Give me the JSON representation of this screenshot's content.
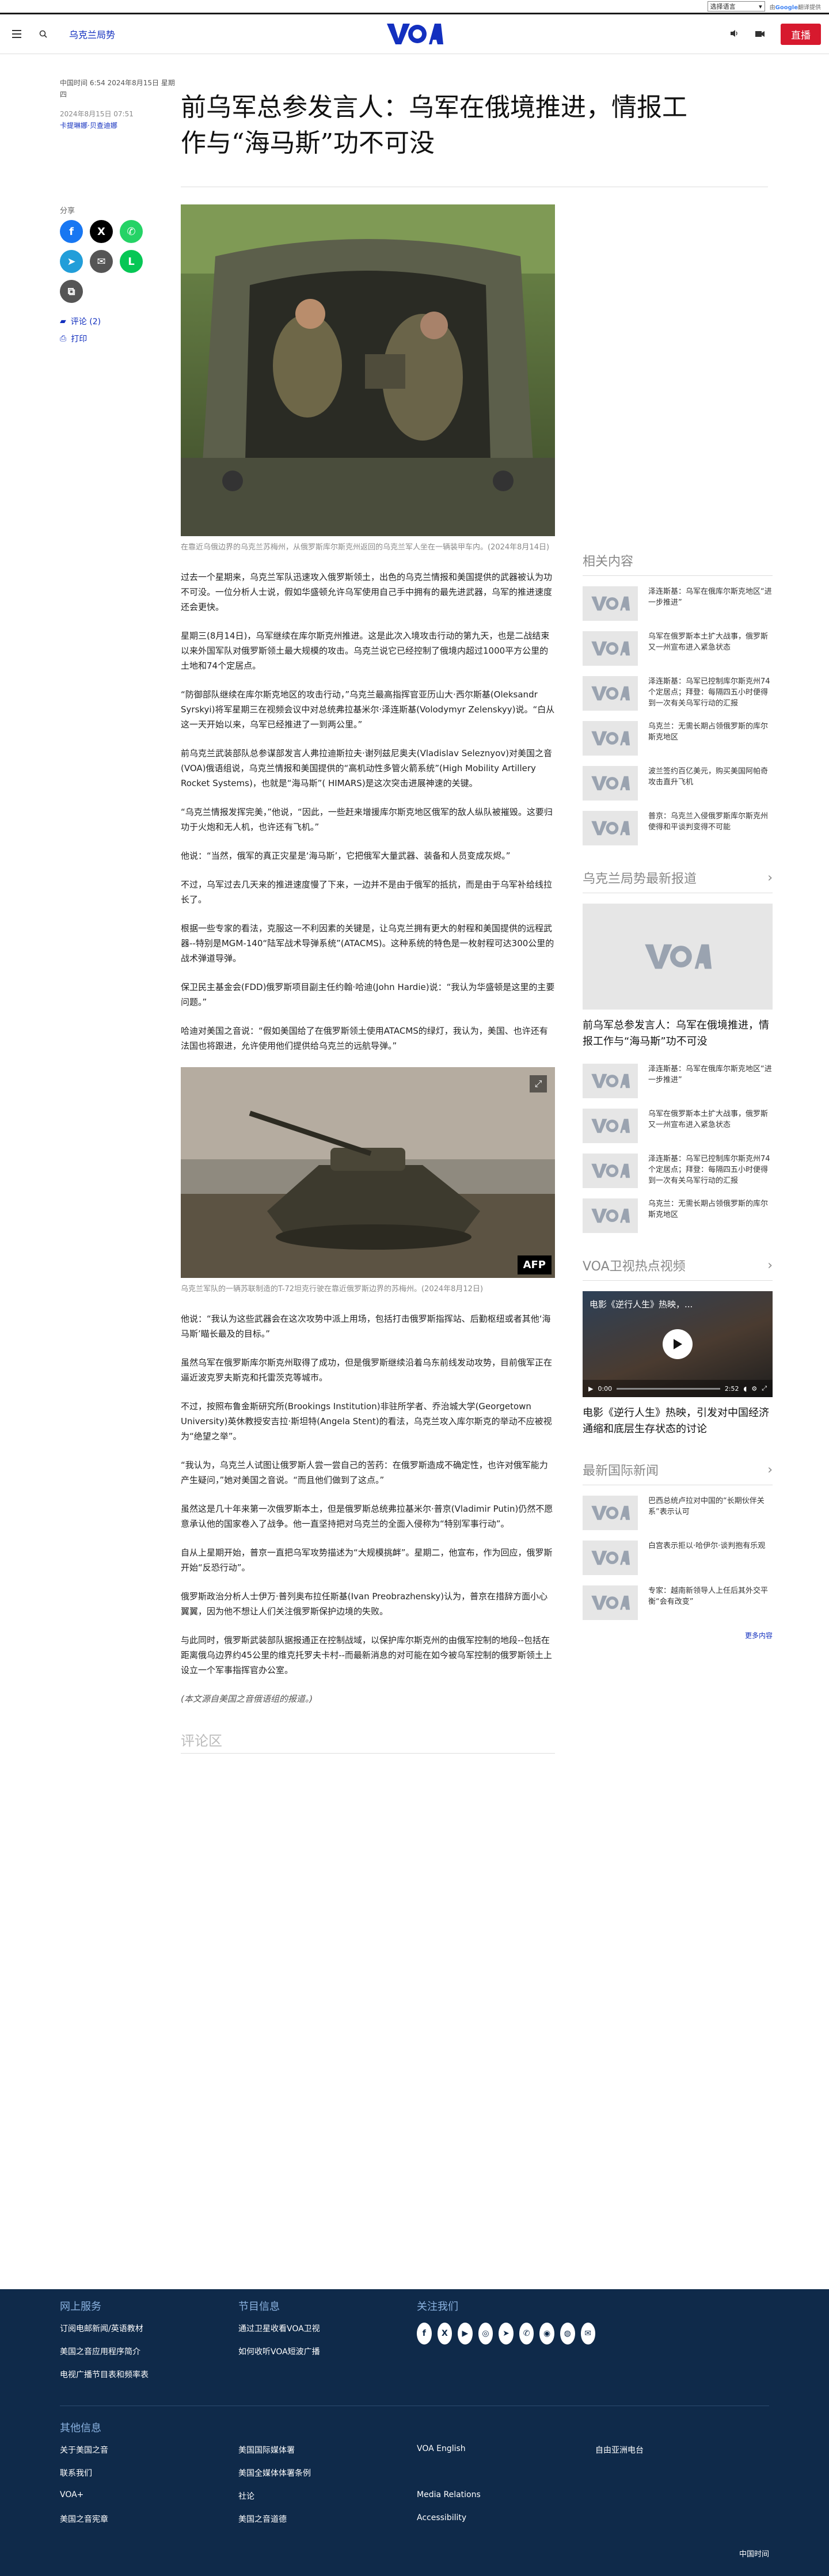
{
  "util": {
    "lang_select": "选择语言",
    "powered_prefix": "由",
    "powered_brand": "Google",
    "powered_suffix": "翻译提供"
  },
  "header": {
    "section_link": "乌克兰局势",
    "logo_text": "VOA",
    "live_label": "直播"
  },
  "article": {
    "dateline": "中国时间 6:54 2024年8月15日 星期四",
    "published": "2024年8月15日 07:51",
    "author": "卡提琳娜·贝查迪娜",
    "title": "前乌军总参发言人：乌军在俄境推进，情报工作与“海马斯”功不可没",
    "hero_caption": "在靠近乌俄边界的乌克兰苏梅州，从俄罗斯库尔斯克州返回的乌克兰军人坐在一辆装甲车内。(2024年8月14日)",
    "paragraphs_a": [
      "过去一个星期来，乌克兰军队迅速攻入俄罗斯领土，出色的乌克兰情报和美国提供的武器被认为功不可没。一位分析人士说，假如华盛顿允许乌军使用自己手中拥有的最先进武器，乌军的推进速度还会更快。",
      "星期三(8月14日)，乌军继续在库尔斯克州推进。这是此次入境攻击行动的第九天，也是二战结束以来外国军队对俄罗斯领土最大规模的攻击。乌克兰说它已经控制了俄境内超过1000平方公里的土地和74个定居点。",
      "“防御部队继续在库尔斯克地区的攻击行动，”乌克兰最高指挥官亚历山大·西尔斯基(Oleksandr Syrskyi)将军星期三在视频会议中对总统弗拉基米尔·泽连斯基(Volodymyr Zelenskyy)说。“白从这一天开始以来，乌军已经推进了一到两公里。”",
      "前乌克兰武装部队总参谋部发言人弗拉迪斯拉夫·谢列兹尼奥夫(Vladislav Seleznyov)对美国之音(VOA)俄语组说，乌克兰情报和美国提供的“高机动性多管火箭系统”(High Mobility Artillery Rocket Systems)，也就是“海马斯”( HIMARS)是这次突击进展神速的关键。",
      "“乌克兰情报发挥完美，”他说，“因此，一些赶来增援库尔斯克地区俄军的敌人纵队被摧毁。这要归功于火炮和无人机，也许还有飞机。”",
      "他说：“当然，俄军的真正灾星是‘海马斯’，它把俄军大量武器、装备和人员变成灰烬。”",
      "不过，乌军过去几天来的推进速度慢了下来，一边并不是由于俄军的抵抗，而是由于乌军补给线拉长了。",
      "根据一些专家的看法，克服这一不利因素的关键是，让乌克兰拥有更大的射程和美国提供的远程武器--特别是MGM-140“陆军战术导弹系统”(ATACMS)。这种系统的特色是一枚射程可达300公里的战术弹道导弹。",
      "保卫民主基金会(FDD)俄罗斯项目副主任约翰·哈迪(John Hardie)说：“我认为华盛顿是这里的主要问题。”",
      "哈迪对美国之音说：“假如美国给了在俄罗斯领土使用ATACMS的绿灯，我认为，美国、也许还有法国也将跟进，允许使用他们提供给乌克兰的远航导弹。”"
    ],
    "inline_caption": "乌克兰军队的一辆苏联制造的T-72坦克行驶在靠近俄罗斯边界的苏梅州。(2024年8月12日)",
    "inline_badge": "AFP",
    "paragraphs_b": [
      "他说：“我认为这些武器会在这次攻势中派上用场，包括打击俄罗斯指挥站、后勤枢纽或者其他‘海马斯’瞄长最及的目标。”",
      "虽然乌军在俄罗斯库尔斯克州取得了成功，但是俄罗斯继续沿着乌东前线发动攻势，目前俄军正在逼近波克罗夫斯克和托雷茨克等城市。",
      "不过，按照布鲁金斯研究所(Brookings Institution)非驻所学者、乔治城大学(Georgetown University)英休教授安吉拉·斯坦特(Angela Stent)的看法，乌克兰攻入库尔斯克的举动不应被视为“绝望之举”。",
      "“我认为，乌克兰人试图让俄罗斯人尝一尝自己的苦药：在俄罗斯造成不确定性，也许对俄军能力产生疑问，”她对美国之音说。“而且他们做到了这点。”",
      "虽然这是几十年来第一次俄罗斯本土，但是俄罗斯总统弗拉基米尔·普京(Vladimir Putin)仍然不愿意承认他的国家卷入了战争。他一直坚持把对乌克兰的全面入侵称为“特别军事行动”。",
      "自从上星期开始，普京一直把乌军攻势描述为“大规模挑衅”。星期二，他宣布，作为回应，俄罗斯开始“反恐行动”。",
      "俄罗斯政治分析人士伊万·普列奥布拉任斯基(Ivan Preobrazhensky)认为，普京在措辞方面小心翼翼，因为他不想让人们关注俄罗斯保护边境的失败。",
      "与此同时，俄罗斯武装部队据报通正在控制战域，以保护库尔斯克州的由俄军控制的地段--包括在距离俄乌边界约45公里的维克托罗夫卡村--而最新消息的对可能在如今被乌军控制的俄罗斯领土上设立一个军事指挥官办公室。"
    ],
    "source_note": "(本文源自美国之音俄语组的报道。)",
    "comments_title": "评论区"
  },
  "share": {
    "label": "分享",
    "comments_link": "评论 (2)",
    "print_link": "打印",
    "icons": [
      {
        "name": "facebook",
        "glyph": "f",
        "color": "#1877f2"
      },
      {
        "name": "x",
        "glyph": "X",
        "color": "#000000"
      },
      {
        "name": "whatsapp",
        "glyph": "✆",
        "color": "#25d366"
      },
      {
        "name": "telegram",
        "glyph": "➤",
        "color": "#229ed9"
      },
      {
        "name": "email",
        "glyph": "✉",
        "color": "#555555"
      },
      {
        "name": "line",
        "glyph": "L",
        "color": "#06c755"
      },
      {
        "name": "copy",
        "glyph": "⧉",
        "color": "#555555"
      }
    ]
  },
  "sidebar": {
    "related_title": "相关内容",
    "related_items": [
      "泽连斯基：乌军在俄库尔斯克地区“进一步推进”",
      "乌军在俄罗斯本土扩大战事，俄罗斯又一州宣布进入紧急状态",
      "泽连斯基：乌军已控制库尔斯克州74个定居点；拜登：每隔四五小时便得到一次有关乌军行动的汇报",
      "乌克兰：无需长期占领俄罗斯的库尔斯克地区",
      "波兰签约百亿美元，购买美国阿帕奇攻击直升飞机",
      "普京：乌克兰入侵俄罗斯库尔斯克州使得和平谈判变得不可能"
    ],
    "latest_title": "乌克兰局势最新报道",
    "latest_feature": "前乌军总参发言人：乌军在俄境推进，情报工作与“海马斯”功不可没",
    "latest_items": [
      "泽连斯基：乌军在俄库尔斯克地区“进一步推进”",
      "乌军在俄罗斯本土扩大战事，俄罗斯又一州宣布进入紧急状态",
      "泽连斯基：乌军已控制库尔斯克州74个定居点；拜登：每隔四五小时便得到一次有关乌军行动的汇报",
      "乌克兰：无需长期占领俄罗斯的库尔斯克地区"
    ],
    "video_title": "VOA卫视热点视频",
    "video_overlay": "电影《逆行人生》热映，...",
    "video_time_current": "0:00",
    "video_time_total": "2:52",
    "video_caption": "电影《逆行人生》热映，引发对中国经济通缩和底层生存状态的讨论",
    "world_title": "最新国际新闻",
    "world_items": [
      "巴西总统卢拉对中国的“长期伙伴关系”表示认可",
      "白宫表示拒以·哈伊尔·谈判抱有乐观",
      "专家：越南新领导人上任后其外交平衡“会有改变”"
    ],
    "more_label": "更多内容"
  },
  "footer": {
    "col1_title": "网上服务",
    "col1_links": [
      "订阅电邮新闻/英语教材",
      "美国之音应用程序简介",
      "电视广播节目表和频率表"
    ],
    "col2_title": "节目信息",
    "col2_links": [
      "通过卫星收看VOA卫视",
      "如何收听VOA短波广播"
    ],
    "col3_title": "关注我们",
    "follow_icons": [
      "f",
      "X",
      "▶",
      "◎",
      "➤",
      "✆",
      "◉",
      "◍",
      "✉"
    ],
    "other_title": "其他信息",
    "other_links": [
      "关于美国之音",
      "美国国际媒体署",
      "VOA English",
      "自由亚洲电台",
      "联系我们",
      "美国全媒体体署条例",
      "",
      "",
      "VOA+",
      "社论",
      "Media Relations",
      "",
      "美国之音宪章",
      "美国之音道德",
      "Accessibility",
      ""
    ],
    "bottom_text": "中国时间"
  }
}
